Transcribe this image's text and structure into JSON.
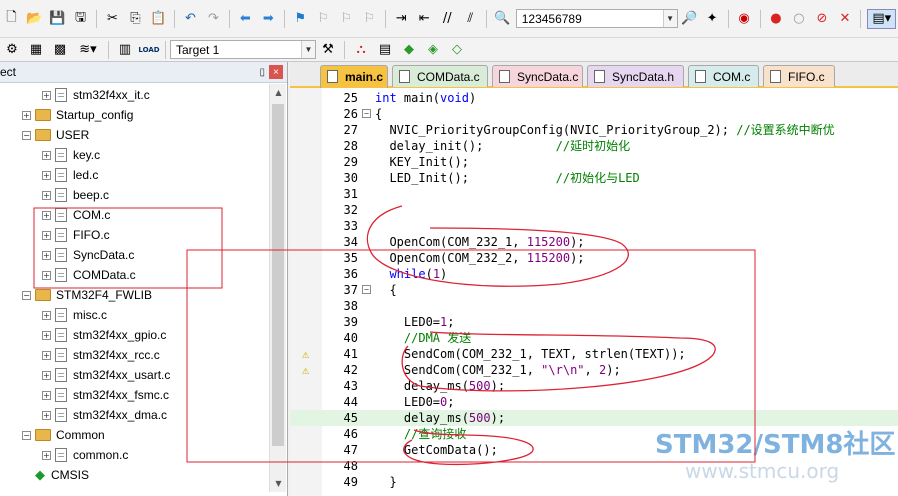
{
  "toolbar": {
    "find_text": "123456789",
    "target": "Target 1",
    "load_label": "LOAD"
  },
  "project": {
    "header": "ect",
    "pin": "ᵖ",
    "close": "×",
    "items": [
      {
        "label": "stm32f4xx_it.c",
        "kind": "file",
        "indent": 2
      },
      {
        "label": "Startup_config",
        "kind": "folder",
        "indent": 1
      },
      {
        "label": "USER",
        "kind": "folder-open",
        "indent": 1
      },
      {
        "label": "key.c",
        "kind": "file",
        "indent": 2
      },
      {
        "label": "led.c",
        "kind": "file",
        "indent": 2
      },
      {
        "label": "beep.c",
        "kind": "file",
        "indent": 2
      },
      {
        "label": "COM.c",
        "kind": "file",
        "indent": 2
      },
      {
        "label": "FIFO.c",
        "kind": "file",
        "indent": 2
      },
      {
        "label": "SyncData.c",
        "kind": "file",
        "indent": 2
      },
      {
        "label": "COMData.c",
        "kind": "file",
        "indent": 2
      },
      {
        "label": "STM32F4_FWLIB",
        "kind": "folder-open",
        "indent": 1
      },
      {
        "label": "misc.c",
        "kind": "file",
        "indent": 2
      },
      {
        "label": "stm32f4xx_gpio.c",
        "kind": "file",
        "indent": 2
      },
      {
        "label": "stm32f4xx_rcc.c",
        "kind": "file",
        "indent": 2
      },
      {
        "label": "stm32f4xx_usart.c",
        "kind": "file",
        "indent": 2
      },
      {
        "label": "stm32f4xx_fsmc.c",
        "kind": "file",
        "indent": 2
      },
      {
        "label": "stm32f4xx_dma.c",
        "kind": "file",
        "indent": 2
      },
      {
        "label": "Common",
        "kind": "folder-open",
        "indent": 1
      },
      {
        "label": "common.c",
        "kind": "file",
        "indent": 2
      },
      {
        "label": "CMSIS",
        "kind": "gem",
        "indent": 1
      }
    ]
  },
  "tabs": [
    {
      "label": "main.c",
      "color": "#f5c242",
      "active": true
    },
    {
      "label": "COMData.c",
      "color": "#d8ecd8"
    },
    {
      "label": "SyncData.c",
      "color": "#f6d5dc"
    },
    {
      "label": "SyncData.h",
      "color": "#e7d6ef"
    },
    {
      "label": "COM.c",
      "color": "#d6ecec"
    },
    {
      "label": "FIFO.c",
      "color": "#f9e2cc"
    }
  ],
  "code": {
    "lines": [
      {
        "n": "25",
        "fold": "",
        "html": "<span class=\"kw\">int</span> main(<span class=\"kw\">void</span>)"
      },
      {
        "n": "26",
        "fold": "−",
        "html": "{"
      },
      {
        "n": "27",
        "fold": "",
        "html": "  NVIC_PriorityGroupConfig(NVIC_PriorityGroup_2); <span class=\"cm\">//设置系统中断优</span>"
      },
      {
        "n": "28",
        "fold": "",
        "html": "  delay_init();          <span class=\"cm\">//延时初始化</span>"
      },
      {
        "n": "29",
        "fold": "",
        "html": "  KEY_Init();"
      },
      {
        "n": "30",
        "fold": "",
        "html": "  LED_Init();            <span class=\"cm\">//初始化与LED</span>"
      },
      {
        "n": "31",
        "fold": "",
        "html": ""
      },
      {
        "n": "32",
        "fold": "",
        "html": ""
      },
      {
        "n": "33",
        "fold": "",
        "html": ""
      },
      {
        "n": "34",
        "fold": "",
        "html": "  OpenCom(COM_232_1, <span class=\"num-lit\">115200</span>);"
      },
      {
        "n": "35",
        "fold": "",
        "html": "  OpenCom(COM_232_2, <span class=\"num-lit\">115200</span>);"
      },
      {
        "n": "36",
        "fold": "",
        "html": "  <span class=\"kw\">while</span>(<span class=\"num-lit\">1</span>)"
      },
      {
        "n": "37",
        "fold": "−",
        "html": "  {"
      },
      {
        "n": "38",
        "fold": "",
        "html": ""
      },
      {
        "n": "39",
        "fold": "",
        "html": "    LED0=<span class=\"num-lit\">1</span>;"
      },
      {
        "n": "40",
        "fold": "",
        "html": "    <span class=\"cm\">//DMA 发送</span>"
      },
      {
        "n": "41",
        "fold": "",
        "html": "    SendCom(COM_232_1, TEXT, strlen(TEXT));",
        "warn": true
      },
      {
        "n": "42",
        "fold": "",
        "html": "    SendCom(COM_232_1, <span class=\"str\">\"\\r\\n\"</span>, <span class=\"num-lit\">2</span>);",
        "warn": true
      },
      {
        "n": "43",
        "fold": "",
        "html": "    delay_ms(<span class=\"num-lit\">500</span>);"
      },
      {
        "n": "44",
        "fold": "",
        "html": "    LED0=<span class=\"num-lit\">0</span>;"
      },
      {
        "n": "45",
        "fold": "",
        "html": "    delay_ms(<span class=\"num-lit\">500</span>);",
        "hl": true
      },
      {
        "n": "46",
        "fold": "",
        "html": "    <span class=\"cm\">//查询接收</span>"
      },
      {
        "n": "47",
        "fold": "",
        "html": "    GetComData();"
      },
      {
        "n": "48",
        "fold": "",
        "html": ""
      },
      {
        "n": "49",
        "fold": "",
        "html": "  }"
      }
    ]
  },
  "watermark": {
    "line1": "STM32/STM8社区",
    "line2": "www.stmcu.org"
  }
}
